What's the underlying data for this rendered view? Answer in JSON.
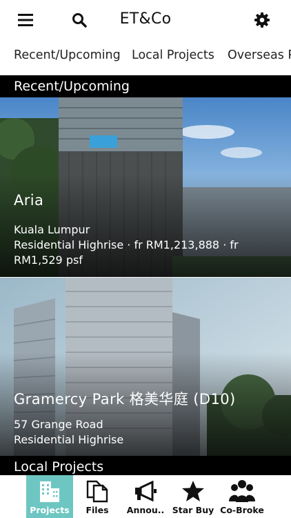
{
  "header": {
    "title": "ET&Co",
    "menu_icon": "hamburger-menu-icon",
    "search_icon": "search-icon",
    "settings_icon": "gear-icon"
  },
  "tabs": [
    {
      "label": "Recent/Upcoming"
    },
    {
      "label": "Local Projects"
    },
    {
      "label": "Overseas P"
    }
  ],
  "sections": [
    {
      "title": "Recent/Upcoming",
      "projects": [
        {
          "name": "Aria",
          "location": "Kuala Lumpur",
          "info": "Residential Highrise · fr RM1,213,888 · fr RM1,529 psf"
        },
        {
          "name": "Gramercy Park 格美华庭 (D10)",
          "location": "57 Grange Road",
          "info": "Residential Highrise"
        }
      ]
    },
    {
      "title": "Local Projects",
      "projects": []
    }
  ],
  "bottom_nav": [
    {
      "label": "Projects",
      "icon": "buildings-icon",
      "active": true
    },
    {
      "label": "Files",
      "icon": "files-icon",
      "active": false
    },
    {
      "label": "Annou..",
      "icon": "megaphone-icon",
      "active": false
    },
    {
      "label": "Star Buy",
      "icon": "star-icon",
      "active": false
    },
    {
      "label": "Co-Broke",
      "icon": "group-icon",
      "active": false
    }
  ],
  "colors": {
    "accent": "#6ec6c2",
    "section_bar": "#000000",
    "text": "#111111"
  }
}
